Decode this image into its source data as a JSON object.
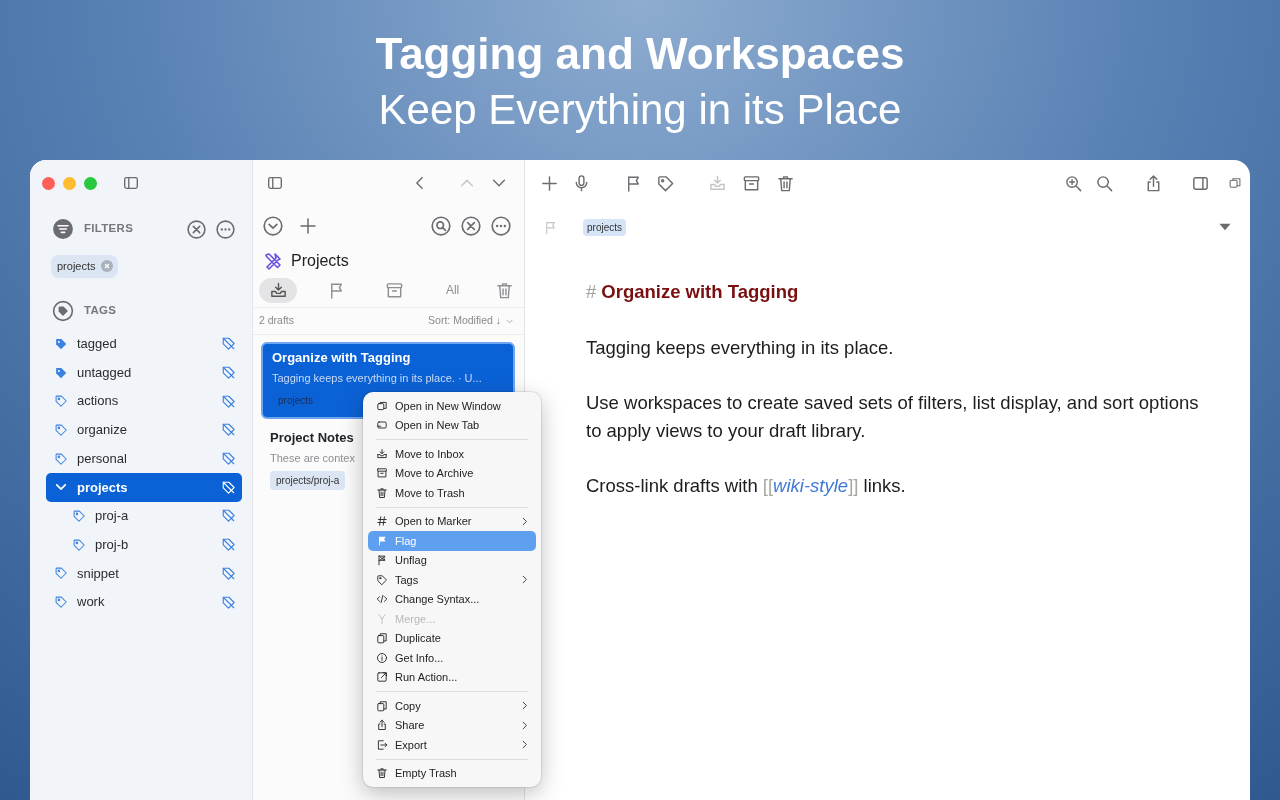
{
  "headline": {
    "title": "Tagging and Workspaces",
    "subtitle": "Keep Everything in its Place"
  },
  "nav": {
    "up_disabled": true
  },
  "sidebar": {
    "filters_label": "FILTERS",
    "filter_chips": [
      {
        "label": "projects"
      }
    ],
    "tags_label": "TAGS",
    "tags": [
      {
        "label": "tagged",
        "kind": "smart",
        "selected": false
      },
      {
        "label": "untagged",
        "kind": "smart",
        "selected": false
      },
      {
        "label": "actions",
        "kind": "tag",
        "selected": false
      },
      {
        "label": "organize",
        "kind": "tag",
        "selected": false
      },
      {
        "label": "personal",
        "kind": "tag",
        "selected": false
      },
      {
        "label": "projects",
        "selected": true,
        "expanded": true,
        "children": [
          {
            "label": "proj-a",
            "kind": "tag",
            "selected": false
          },
          {
            "label": "proj-b",
            "kind": "tag",
            "selected": false
          }
        ]
      },
      {
        "label": "snippet",
        "kind": "tag",
        "selected": false
      },
      {
        "label": "work",
        "kind": "tag",
        "selected": false
      }
    ]
  },
  "draft_list": {
    "title": "Projects",
    "filter_tabs": [
      {
        "kind": "inbox",
        "selected": true
      },
      {
        "kind": "flagged",
        "selected": false
      },
      {
        "kind": "archive",
        "selected": false
      },
      {
        "kind": "all",
        "label": "All",
        "selected": false
      },
      {
        "kind": "trash",
        "selected": false
      }
    ],
    "count": "2 drafts",
    "sort": "Sort: Modified ↓",
    "drafts": [
      {
        "title": "Organize with Tagging",
        "preview": "Tagging keeps everything in its place. · U...",
        "tag": "projects",
        "selected": true
      },
      {
        "title": "Project Notes",
        "preview": "These are contex",
        "tag": "projects/proj-a",
        "selected": false
      }
    ]
  },
  "editor_toolbar": {
    "inbox_disabled": true
  },
  "editor": {
    "tag": "projects",
    "heading_marker": "#",
    "heading": "Organize with Tagging",
    "paragraphs": [
      [
        {
          "kind": "text",
          "text": "Tagging keeps everything in its place."
        }
      ],
      [
        {
          "kind": "text",
          "text": "Use workspaces to create saved sets of filters, list display, and sort options to apply views to your draft library."
        }
      ],
      [
        {
          "kind": "text",
          "text": "Cross-link drafts with "
        },
        {
          "kind": "bracket",
          "text": "[["
        },
        {
          "kind": "link",
          "text": "wiki-style"
        },
        {
          "kind": "bracket",
          "text": "]]"
        },
        {
          "kind": "text",
          "text": " links."
        }
      ]
    ]
  },
  "context_menu": {
    "groups": [
      [
        {
          "label": "Open in New Window",
          "submenu": false,
          "disabled": false,
          "selected": false
        },
        {
          "label": "Open in New Tab",
          "submenu": false,
          "disabled": false,
          "selected": false
        }
      ],
      [
        {
          "label": "Move to Inbox",
          "submenu": false,
          "disabled": false,
          "selected": false
        },
        {
          "label": "Move to Archive",
          "submenu": false,
          "disabled": false,
          "selected": false
        },
        {
          "label": "Move to Trash",
          "submenu": false,
          "disabled": false,
          "selected": false
        }
      ],
      [
        {
          "label": "Open to Marker",
          "submenu": true,
          "disabled": false,
          "selected": false
        },
        {
          "label": "Flag",
          "submenu": false,
          "disabled": false,
          "selected": true
        },
        {
          "label": "Unflag",
          "submenu": false,
          "disabled": false,
          "selected": false
        },
        {
          "label": "Tags",
          "submenu": true,
          "disabled": false,
          "selected": false
        },
        {
          "label": "Change Syntax...",
          "submenu": false,
          "disabled": false,
          "selected": false
        },
        {
          "label": "Merge...",
          "submenu": false,
          "disabled": true,
          "selected": false
        },
        {
          "label": "Duplicate",
          "submenu": false,
          "disabled": false,
          "selected": false
        },
        {
          "label": "Get Info...",
          "submenu": false,
          "disabled": false,
          "selected": false
        },
        {
          "label": "Run Action...",
          "submenu": false,
          "disabled": false,
          "selected": false
        }
      ],
      [
        {
          "label": "Copy",
          "submenu": true,
          "disabled": false,
          "selected": false
        },
        {
          "label": "Share",
          "submenu": true,
          "disabled": false,
          "selected": false
        },
        {
          "label": "Export",
          "submenu": true,
          "disabled": false,
          "selected": false
        }
      ],
      [
        {
          "label": "Empty Trash",
          "submenu": false,
          "disabled": false,
          "selected": false
        }
      ]
    ]
  }
}
